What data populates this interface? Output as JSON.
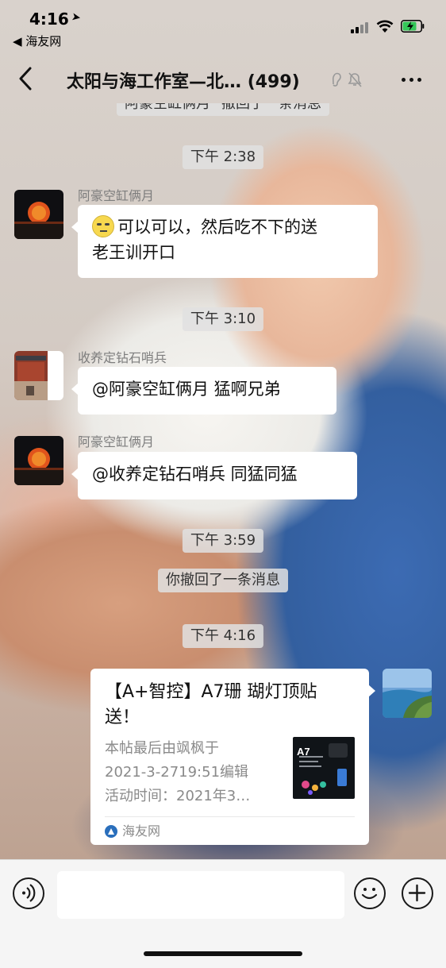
{
  "status_bar": {
    "time": "4:16",
    "back_app": "◀ 海友网"
  },
  "header": {
    "title": "太阳与海工作室—北…",
    "member_count": "(499)"
  },
  "messages": {
    "top_cut": "阿豪空缸俩月\" 撤回了一条消息",
    "time1": "下午 2:38",
    "m1_sender": "阿豪空缸俩月",
    "m1_line1": "可以可以，然后吃不下的送",
    "m1_line2": "老王训开口",
    "time2": "下午 3:10",
    "m2_sender": "收养定钻石哨兵",
    "m2_text": "@阿豪空缸俩月 猛啊兄弟",
    "m3_sender": "阿豪空缸俩月",
    "m3_text": "@收养定钻石哨兵 同猛同猛",
    "time3": "下午 3:59",
    "recall_notice": "你撤回了一条消息",
    "time4": "下午 4:16"
  },
  "link_card": {
    "title_line1": "【A+智控】A7珊 瑚灯顶贴",
    "title_line2": "送！",
    "desc_line1": "本帖最后由飒枫于",
    "desc_line2": "2021-3-2719:51编辑",
    "desc_line3": "活动时间：2021年3…",
    "thumb_label": "A7",
    "source": "海友网"
  },
  "input": {
    "placeholder": ""
  },
  "colors": {
    "bubble": "#ffffff",
    "system_pill": "#e1e1e1",
    "input_bar": "#f5f5f5",
    "battery_green": "#35c759"
  }
}
